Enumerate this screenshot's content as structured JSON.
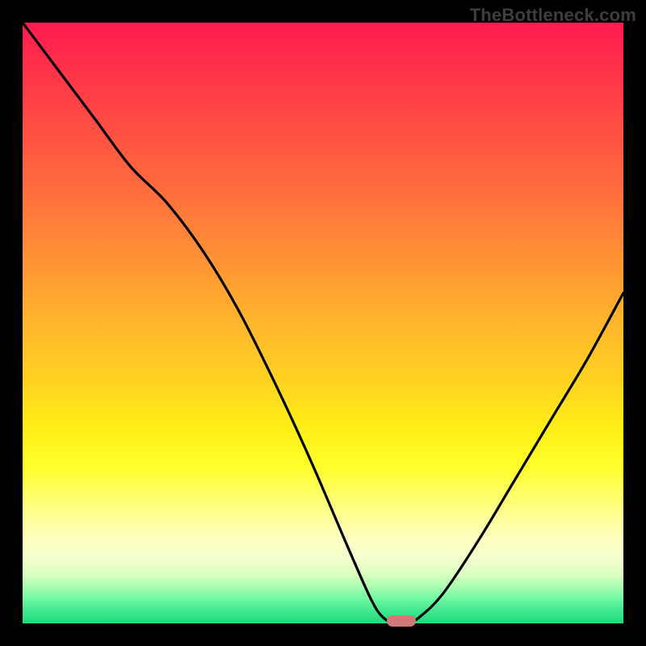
{
  "watermark": "TheBottleneck.com",
  "colors": {
    "curve_stroke": "#000000",
    "marker_fill": "#cf7a78",
    "frame_bg": "#000000"
  },
  "chart_data": {
    "type": "line",
    "title": "",
    "xlabel": "",
    "ylabel": "",
    "xlim": [
      0,
      100
    ],
    "ylim": [
      0,
      100
    ],
    "grid": false,
    "legend": false,
    "gradient_scale_note": "background maps y=100 (top) to red and y=0 (bottom) to green",
    "series": [
      {
        "name": "bottleneck-curve",
        "x": [
          0,
          6,
          12,
          18,
          24,
          30,
          36,
          42,
          48,
          54,
          58,
          60,
          62,
          64,
          66,
          70,
          76,
          82,
          88,
          94,
          100
        ],
        "y": [
          100,
          92,
          84,
          76,
          70,
          62,
          52,
          40,
          27,
          13,
          4,
          1,
          0,
          0,
          1,
          5,
          14,
          24,
          34,
          44,
          55
        ]
      }
    ],
    "marker": {
      "x": 63,
      "y": 0,
      "shape": "pill"
    }
  }
}
